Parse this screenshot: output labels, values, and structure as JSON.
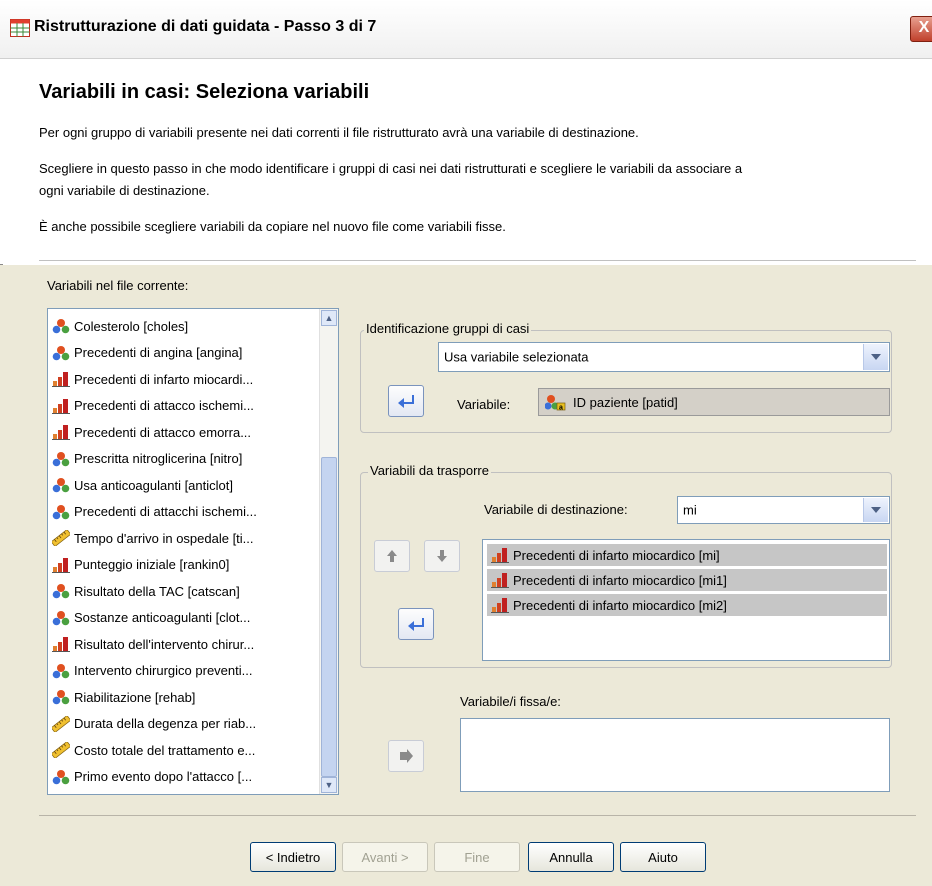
{
  "window": {
    "title": "Ristrutturazione di dati guidata - Passo 3 di 7",
    "close_label": "X"
  },
  "header": {
    "heading": "Variabili in casi: Seleziona variabili",
    "para1": "Per ogni gruppo di variabili presente nei dati correnti il file ristrutturato avrà una variabile di destinazione.",
    "para2a": "Scegliere in questo passo in che modo identificare i gruppi di casi nei dati ristrutturati e scegliere le variabili da associare a",
    "para2b": "ogni variabile di destinazione.",
    "para3": "È anche possibile scegliere variabili da copiare nel nuovo file come variabili fisse."
  },
  "current_vars": {
    "label": "Variabili nel file corrente:",
    "items": [
      {
        "label": "Colesterolo [choles]",
        "icon": "nominal-icon"
      },
      {
        "label": "Precedenti di angina [angina]",
        "icon": "nominal-icon"
      },
      {
        "label": "Precedenti di infarto miocardi...",
        "icon": "ordinal-icon"
      },
      {
        "label": "Precedenti di attacco ischemi...",
        "icon": "ordinal-icon"
      },
      {
        "label": "Precedenti di attacco emorra...",
        "icon": "ordinal-icon"
      },
      {
        "label": "Prescritta nitroglicerina [nitro]",
        "icon": "nominal-icon"
      },
      {
        "label": "Usa anticoagulanti [anticlot]",
        "icon": "nominal-icon"
      },
      {
        "label": "Precedenti di attacchi ischemi...",
        "icon": "nominal-icon"
      },
      {
        "label": "Tempo d'arrivo in ospedale [ti...",
        "icon": "scale-icon"
      },
      {
        "label": "Punteggio iniziale [rankin0]",
        "icon": "ordinal-icon"
      },
      {
        "label": "Risultato della TAC [catscan]",
        "icon": "nominal-icon"
      },
      {
        "label": "Sostanze anticoagulanti [clot...",
        "icon": "nominal-icon"
      },
      {
        "label": "Risultato dell'intervento chirur...",
        "icon": "ordinal-icon"
      },
      {
        "label": "Intervento chirurgico preventi...",
        "icon": "nominal-icon"
      },
      {
        "label": "Riabilitazione [rehab]",
        "icon": "nominal-icon"
      },
      {
        "label": "Durata della degenza per riab...",
        "icon": "scale-icon"
      },
      {
        "label": "Costo totale del trattamento e...",
        "icon": "scale-icon"
      },
      {
        "label": "Primo evento dopo l'attacco [...",
        "icon": "nominal-icon"
      }
    ]
  },
  "case_group": {
    "title": "Identificazione gruppi di casi",
    "method_selected": "Usa variabile selezionata",
    "variable_label": "Variabile:",
    "variable_value": "ID paziente [patid]"
  },
  "transpose": {
    "title": "Variabili da trasporre",
    "target_label": "Variabile di destinazione:",
    "target_value": "mi",
    "items": [
      "Precedenti di infarto miocardico [mi]",
      "Precedenti di infarto miocardico [mi1]",
      "Precedenti di infarto miocardico [mi2]"
    ]
  },
  "fixed": {
    "label": "Variabile/i fissa/e:"
  },
  "buttons": {
    "back": "< Indietro",
    "next": "Avanti >",
    "finish": "Fine",
    "cancel": "Annulla",
    "help": "Aiuto"
  },
  "colors": {
    "accent_blue": "#3a6fd8",
    "dialog_bg": "#ece9d8",
    "selection_bg": "#c6c6c6"
  }
}
